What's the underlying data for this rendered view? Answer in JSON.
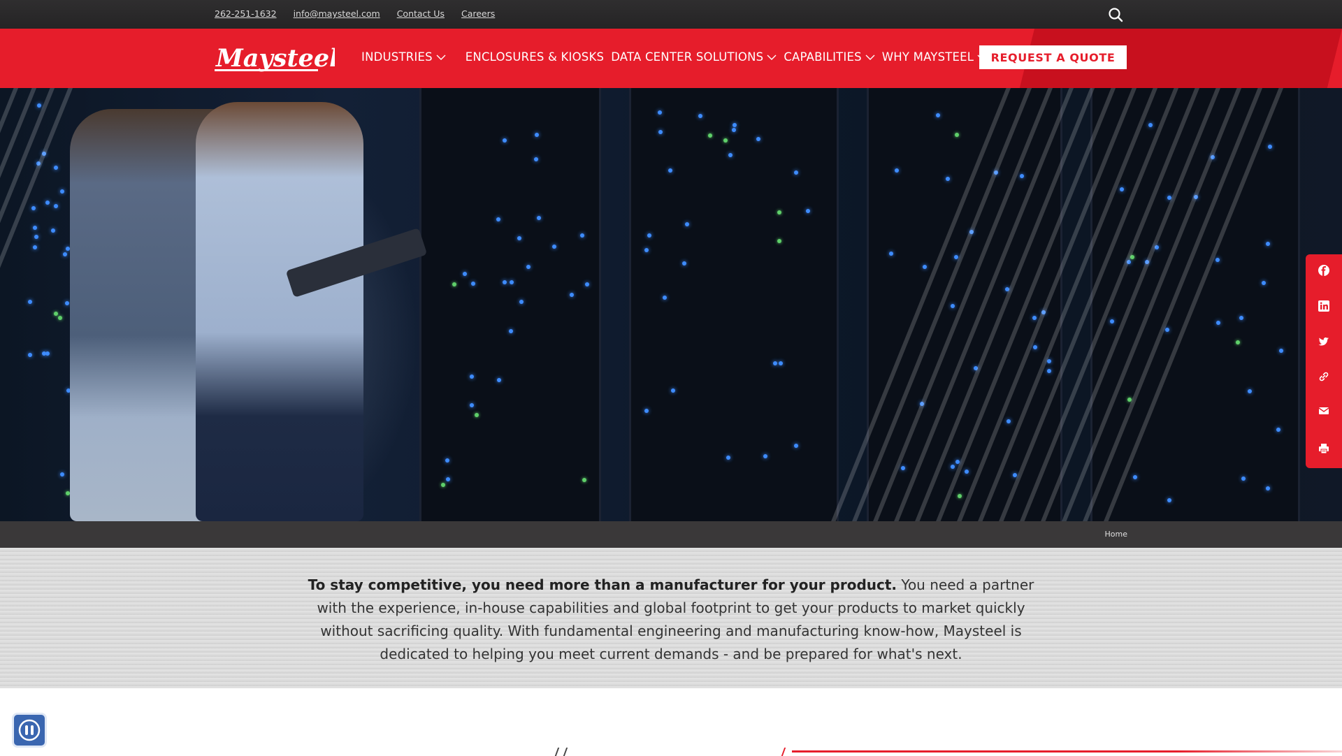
{
  "topbar": {
    "phone": "262-251-1632",
    "email": "info@maysteel.com",
    "contact": "Contact Us",
    "careers": "Careers"
  },
  "nav": {
    "logo_text": "Maysteel",
    "items": [
      "INDUSTRIES",
      "ENCLOSURES & KIOSKS",
      "DATA CENTER SOLUTIONS",
      "CAPABILITIES",
      "WHY MAYSTEEL"
    ],
    "cta": "REQUEST A QUOTE"
  },
  "breadcrumb": {
    "home": "Home"
  },
  "intro": {
    "lead": "To stay competitive, you need more than a manufacturer for your product.",
    "body": " You need a partner with the experience, in-house capabilities and global footprint to get your products to market quickly without sacrificing quality. With fundamental engineering and manufacturing know-how, Maysteel is dedicated to helping you meet current demands - and be prepared for what's next."
  },
  "share_icons": [
    "facebook-icon",
    "linkedin-icon",
    "twitter-icon",
    "link-icon",
    "email-icon",
    "print-icon"
  ],
  "colors": {
    "brand_red": "#e61d2b",
    "dark_bar": "#2f2e2f"
  }
}
